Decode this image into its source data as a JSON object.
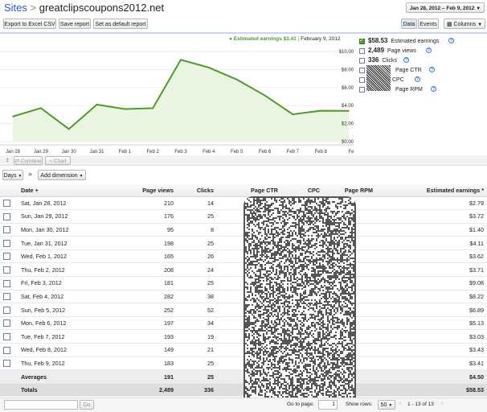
{
  "header": {
    "breadcrumb_root": "Sites",
    "breadcrumb_sep": ">",
    "site_name": "greatclipscoupons2012.net",
    "date_range": "Jan 28, 2012 – Feb 9, 2012"
  },
  "toolbar": {
    "export_label": "Export to Excel CSV",
    "save_report_label": "Save report",
    "set_default_label": "Set as default report",
    "data_tab_label": "Data",
    "events_tab_label": "Events",
    "columns_label": "Columns"
  },
  "chart_header": {
    "series_label": "Estimated earnings $3.41",
    "separator": "|",
    "date_label": "February 9, 2012"
  },
  "chart_data": {
    "type": "area",
    "categories": [
      "Jan 28",
      "Jan 29",
      "Jan 30",
      "Jan 31",
      "Feb 1",
      "Feb 2",
      "Feb 3",
      "Feb 4",
      "Feb 5",
      "Feb 6",
      "Feb 7",
      "Feb 8",
      "Fe"
    ],
    "series": [
      {
        "name": "Estimated earnings",
        "values": [
          2.79,
          3.72,
          1.4,
          4.11,
          3.62,
          3.71,
          9.08,
          8.22,
          6.89,
          5.13,
          3.03,
          3.43,
          3.41
        ]
      }
    ],
    "ylim": [
      0,
      10
    ],
    "yticks": [
      "$0.00",
      "$2.00",
      "$4.00",
      "$6.00",
      "$8.00",
      "$10.00"
    ],
    "line_color": "#4e9a2a",
    "fill_color": "#e9f5e1",
    "grid": true
  },
  "legend": {
    "items": [
      {
        "value": "$58.53",
        "label": "Estimated earnings",
        "checked": true
      },
      {
        "value": "2,489",
        "label": "Page views",
        "checked": false
      },
      {
        "value": "336",
        "label": "Clicks",
        "checked": false
      },
      {
        "value": "",
        "label": "Page CTR",
        "checked": false
      },
      {
        "value": "",
        "label": "CPC",
        "checked": false
      },
      {
        "value": "",
        "label": "Page RPM",
        "checked": false
      }
    ]
  },
  "chart_controls": {
    "combine_label": "Combine",
    "chart_label": "Chart"
  },
  "filters": {
    "days_label": "Days",
    "arrow_label": "»",
    "add_dimension_label": "Add dimension"
  },
  "table": {
    "headers": [
      "Date +",
      "Page views",
      "Clicks",
      "Page CTR",
      "CPC",
      "Page RPM",
      "Estimated earnings *"
    ],
    "rows": [
      {
        "date": "Sat, Jan 28, 2012",
        "views": "210",
        "clicks": "14",
        "earnings": "$2.79"
      },
      {
        "date": "Sun, Jan 29, 2012",
        "views": "176",
        "clicks": "25",
        "earnings": "$3.72"
      },
      {
        "date": "Mon, Jan 30, 2012",
        "views": "95",
        "clicks": "8",
        "earnings": "$1.40"
      },
      {
        "date": "Tue, Jan 31, 2012",
        "views": "198",
        "clicks": "25",
        "earnings": "$4.11"
      },
      {
        "date": "Wed, Feb 1, 2012",
        "views": "165",
        "clicks": "26",
        "earnings": "$3.62"
      },
      {
        "date": "Thu, Feb 2, 2012",
        "views": "208",
        "clicks": "24",
        "earnings": "$3.71"
      },
      {
        "date": "Fri, Feb 3, 2012",
        "views": "181",
        "clicks": "25",
        "earnings": "$9.08"
      },
      {
        "date": "Sat, Feb 4, 2012",
        "views": "282",
        "clicks": "38",
        "earnings": "$8.22"
      },
      {
        "date": "Sun, Feb 5, 2012",
        "views": "252",
        "clicks": "52",
        "earnings": "$6.89"
      },
      {
        "date": "Mon, Feb 6, 2012",
        "views": "197",
        "clicks": "34",
        "earnings": "$5.13"
      },
      {
        "date": "Tue, Feb 7, 2012",
        "views": "193",
        "clicks": "19",
        "earnings": "$3.03"
      },
      {
        "date": "Wed, Feb 8, 2012",
        "views": "149",
        "clicks": "21",
        "earnings": "$3.43"
      },
      {
        "date": "Thu, Feb 9, 2012",
        "views": "183",
        "clicks": "25",
        "earnings": "$3.41"
      }
    ],
    "averages": {
      "label": "Averages",
      "views": "191",
      "clicks": "25",
      "earnings": "$4.50"
    },
    "totals": {
      "label": "Totals",
      "views": "2,489",
      "clicks": "336",
      "earnings": "$58.53"
    }
  },
  "footer": {
    "go_label": "Go",
    "go_to_page_label": "Go to page:",
    "page_value": "1",
    "show_rows_label": "Show rows:",
    "rows_value": "50",
    "range_label": "1 - 13 of 13"
  },
  "colors": {
    "link_blue": "#2a5db0",
    "chart_line": "#4e9a2a",
    "accent_border": "#c8d6ec"
  }
}
